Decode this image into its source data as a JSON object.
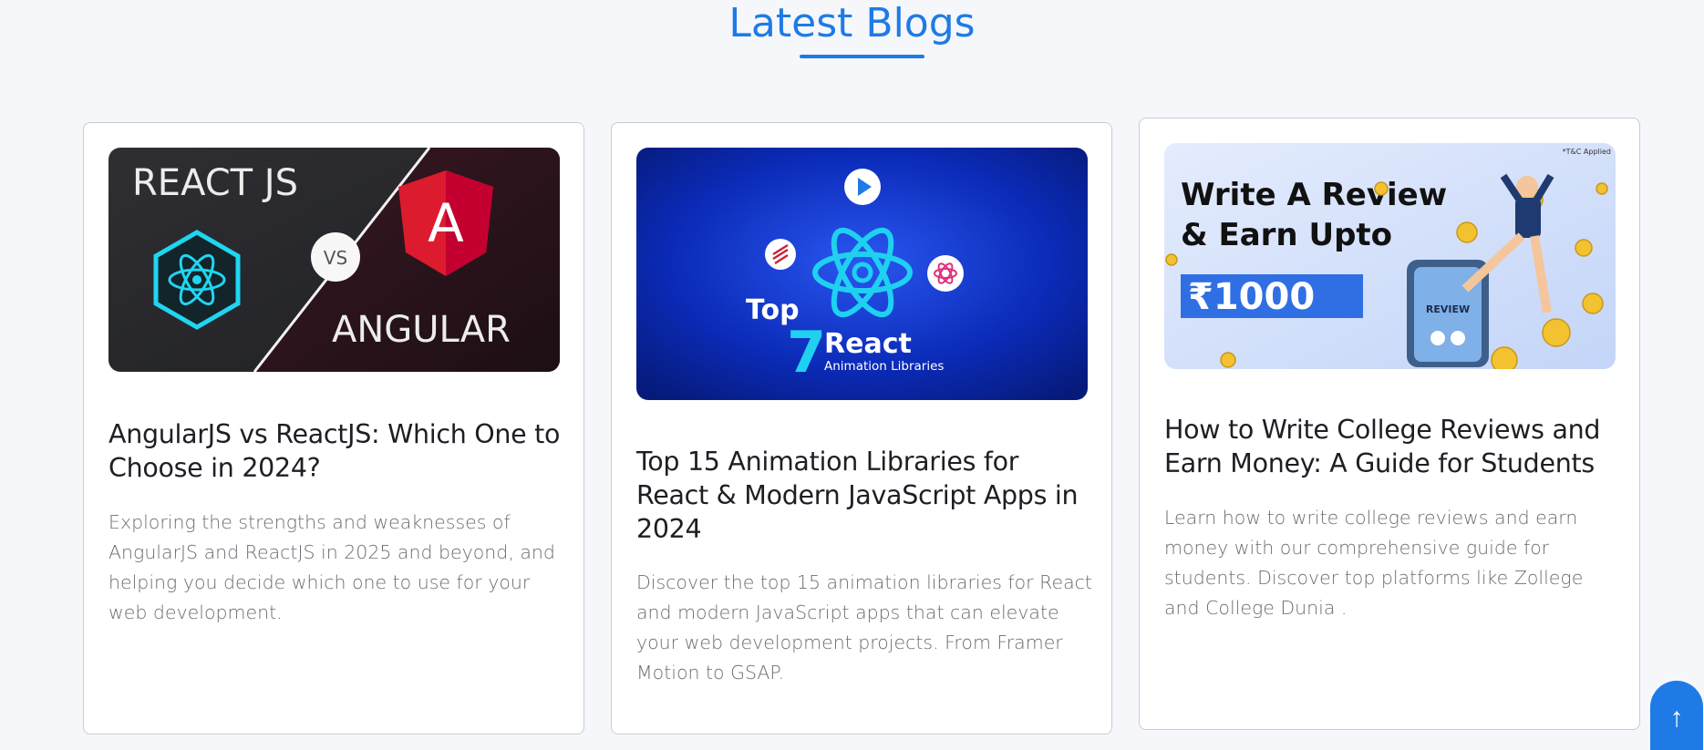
{
  "section": {
    "title": "Latest Blogs"
  },
  "colors": {
    "accent": "#1e7be6",
    "card_border": "#c9ccd1",
    "title_text": "#1c1f24",
    "excerpt_text": "#6a6d73",
    "background": "#f5f7fa"
  },
  "posts": [
    {
      "title": "AngularJS vs ReactJS: Which One to Choose in 2024?",
      "excerpt": "Exploring the strengths and weaknesses of AngularJS and ReactJS in 2025 and beyond, and helping you decide which one to use for your web development.",
      "image": {
        "icon": "react-vs-angular-banner",
        "top_text": "REACT JS",
        "vs_text": "VS",
        "bottom_text": "ANGULAR",
        "badge_letter": "A"
      }
    },
    {
      "title": "Top 15 Animation Libraries for React & Modern JavaScript Apps in 2024",
      "excerpt": "Discover the top 15 animation libraries for React and modern JavaScript apps that can elevate your web development projects. From Framer Motion to GSAP.",
      "image": {
        "icon": "react-atom-banner",
        "top_word": "Top",
        "number": "7",
        "react_word": "React",
        "sub_text": "Animation Libraries"
      }
    },
    {
      "title": "How to Write College Reviews and Earn Money: A Guide for Students",
      "excerpt": "Learn how to write college reviews and earn money with our comprehensive guide for students. Discover top platforms like Zollege and College Dunia .",
      "image": {
        "icon": "review-earn-banner",
        "tc_text": "*T&C Applied",
        "line1": "Write A Review",
        "line2": "& Earn Upto",
        "amount": "₹1000",
        "phone_label": "REVIEW"
      }
    }
  ],
  "scroll_top": {
    "icon": "arrow-up-icon",
    "glyph": "↑"
  }
}
